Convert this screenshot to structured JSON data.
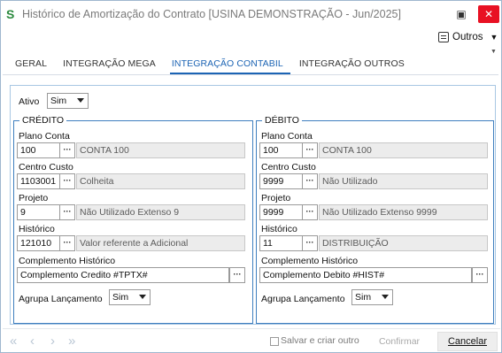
{
  "window": {
    "title": "Histórico de Amortização do Contrato [USINA DEMONSTRAÇÃO - Jun/2025]",
    "app_icon": "S"
  },
  "toolbar": {
    "outros_label": "Outros"
  },
  "tabs": [
    {
      "label": "GERAL",
      "active": false
    },
    {
      "label": "INTEGRAÇÃO MEGA",
      "active": false
    },
    {
      "label": "INTEGRAÇÃO CONTABIL",
      "active": true
    },
    {
      "label": "INTEGRAÇÃO OUTROS",
      "active": false
    }
  ],
  "ativo": {
    "label": "Ativo",
    "value": "Sim"
  },
  "credito": {
    "title": "CRÉDITO",
    "plano_conta": {
      "label": "Plano Conta",
      "code": "100",
      "desc": "CONTA 100"
    },
    "centro_custo": {
      "label": "Centro Custo",
      "code": "1103001",
      "desc": "Colheita"
    },
    "projeto": {
      "label": "Projeto",
      "code": "9",
      "desc": "Não Utilizado Extenso 9"
    },
    "historico": {
      "label": "Histórico",
      "code": "121010",
      "desc": "Valor referente a Adicional"
    },
    "complemento": {
      "label": "Complemento Histórico",
      "value": "Complemento Credito #TPTX#"
    },
    "agrupa": {
      "label": "Agrupa Lançamento",
      "value": "Sim"
    }
  },
  "debito": {
    "title": "DÉBITO",
    "plano_conta": {
      "label": "Plano Conta",
      "code": "100",
      "desc": "CONTA 100"
    },
    "centro_custo": {
      "label": "Centro Custo",
      "code": "9999",
      "desc": "Não Utilizado"
    },
    "projeto": {
      "label": "Projeto",
      "code": "9999",
      "desc": "Não Utilizado Extenso 9999"
    },
    "historico": {
      "label": "Histórico",
      "code": "11",
      "desc": "DISTRIBUIÇÃO"
    },
    "complemento": {
      "label": "Complemento Histórico",
      "value": "Complemento Debito #HIST#"
    },
    "agrupa": {
      "label": "Agrupa Lançamento",
      "value": "Sim"
    }
  },
  "lookup_button": "···",
  "footer": {
    "salvar_label": "Salvar e criar outro",
    "confirmar_label": "Confirmar",
    "cancelar_label": "Cancelar"
  },
  "colors": {
    "accent": "#1c64b4",
    "group_border": "#3f7fbf",
    "close_red": "#e81123"
  }
}
